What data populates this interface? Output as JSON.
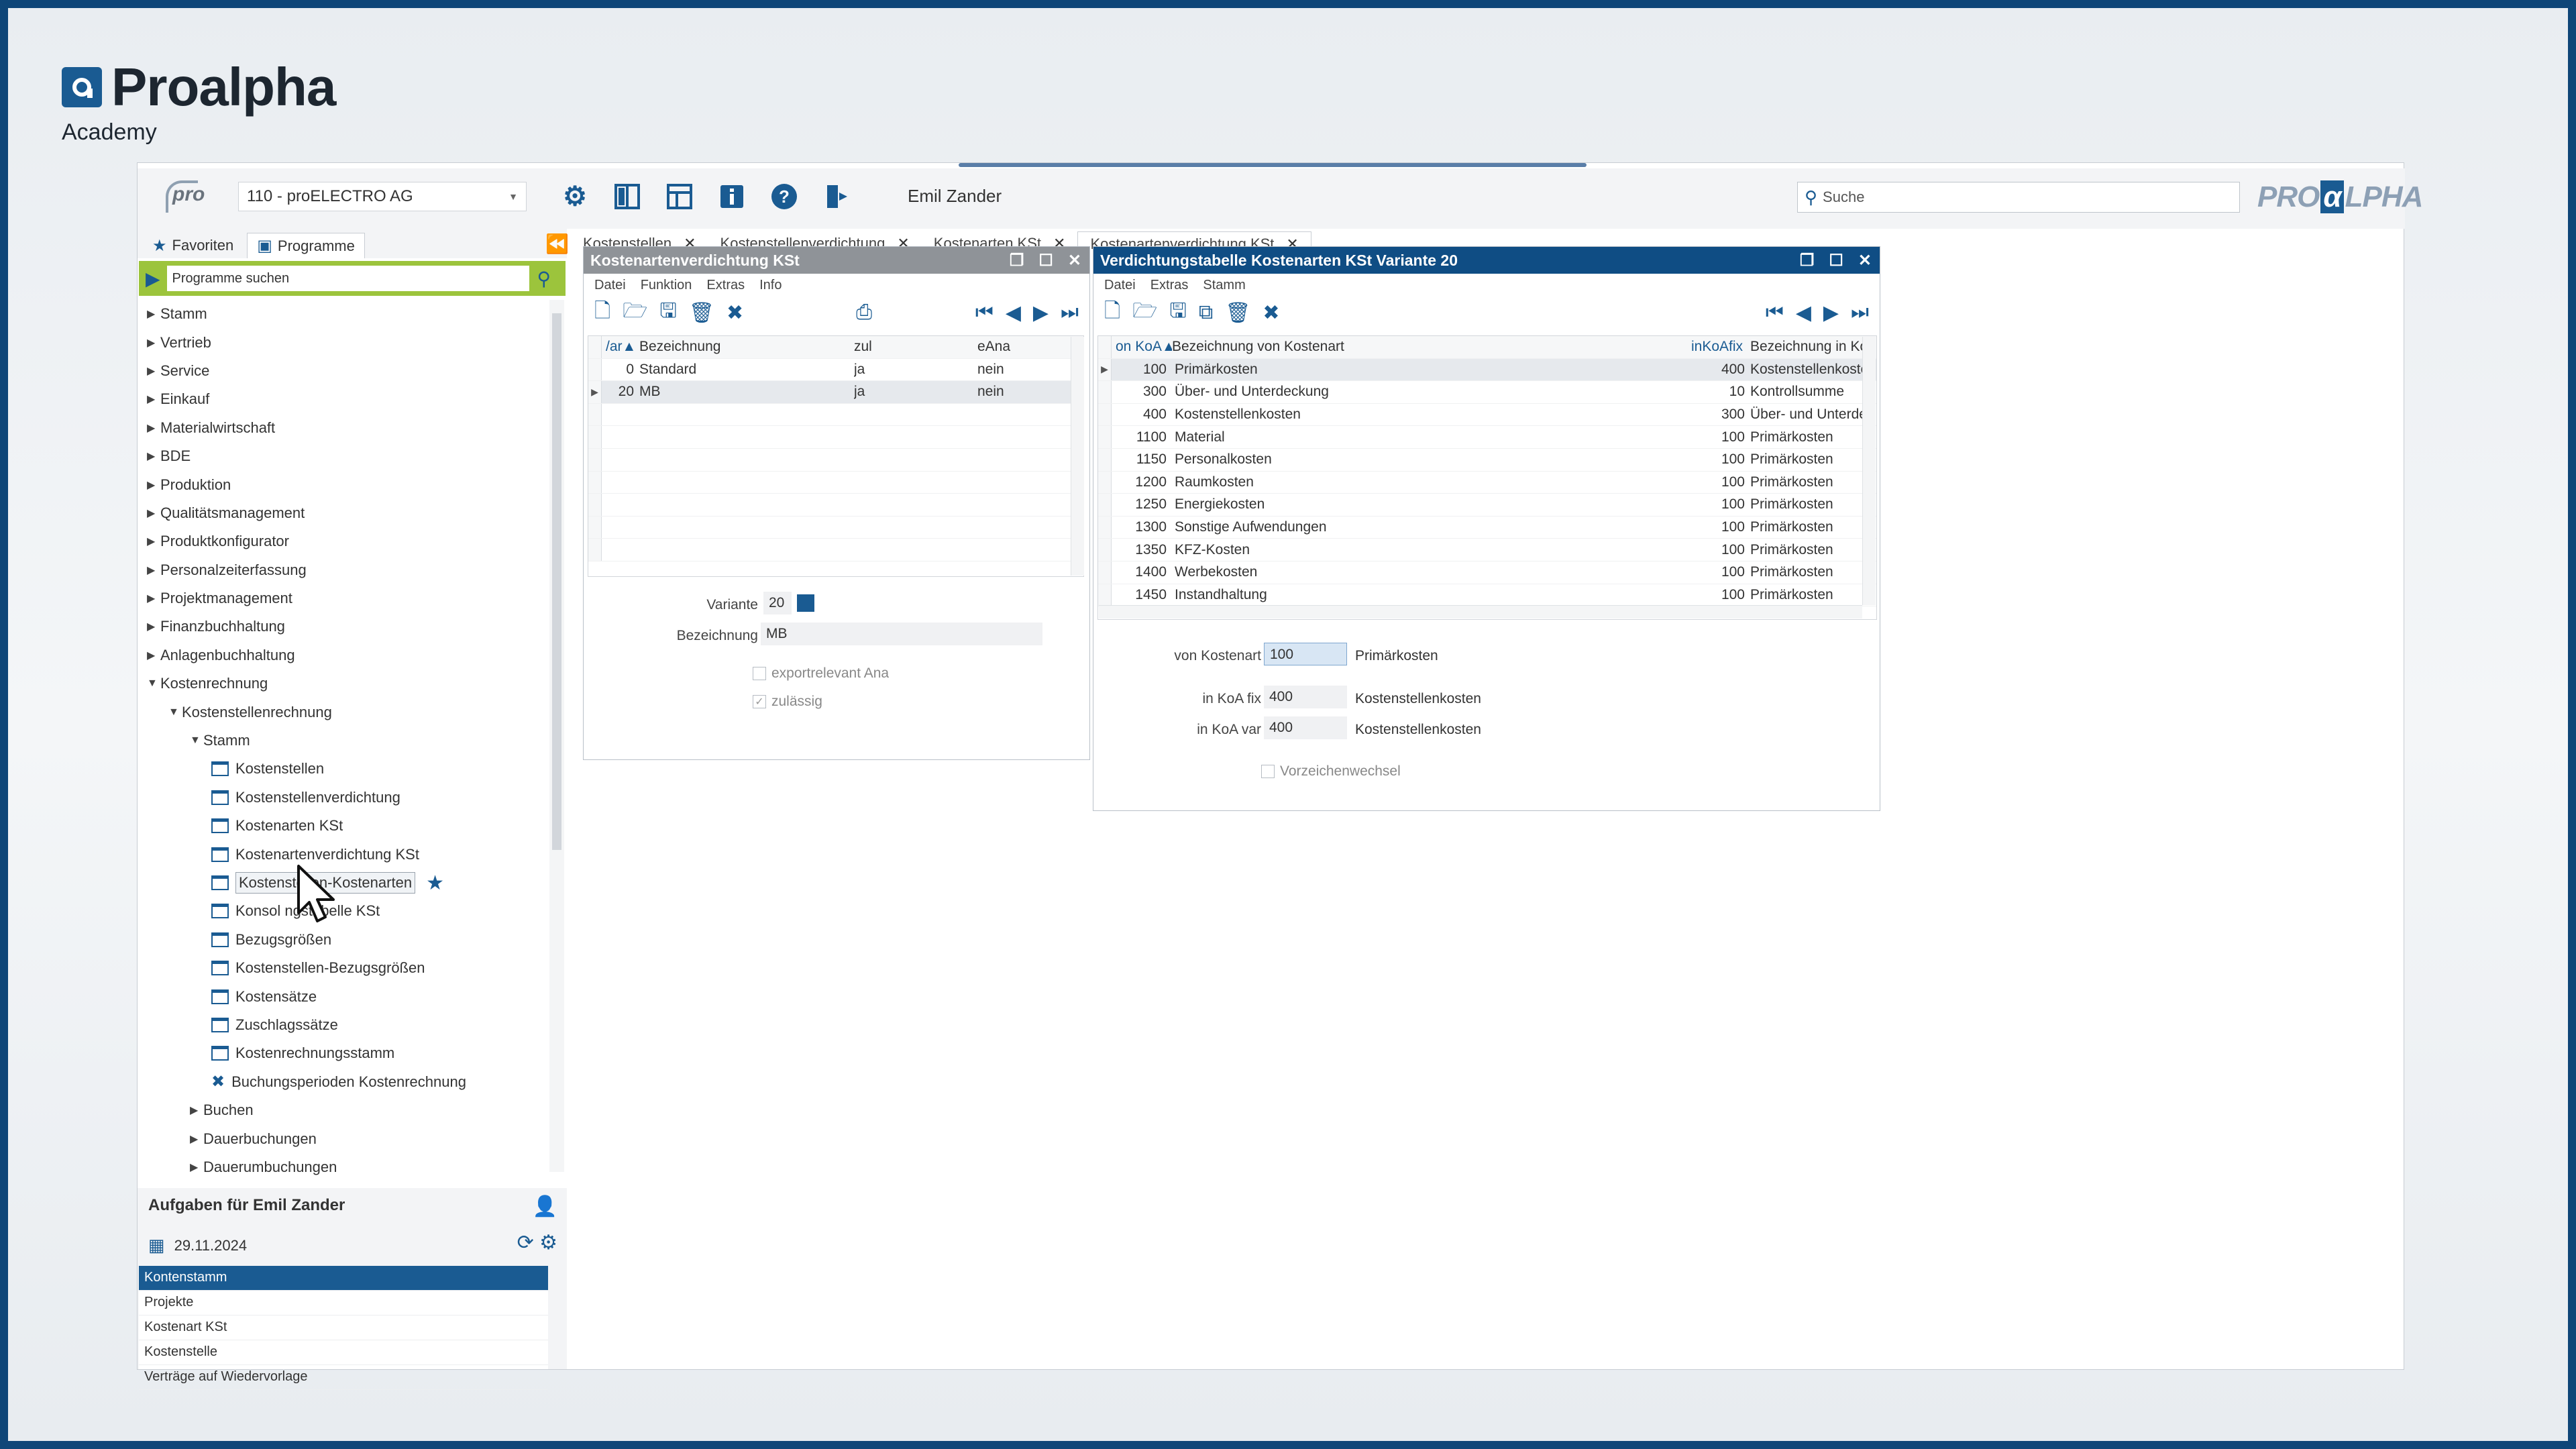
{
  "brand": {
    "name": "Proalpha",
    "subtitle": "Academy"
  },
  "topbar": {
    "pro_logo": "pro",
    "company": "110 - proELECTRO AG",
    "user": "Emil Zander",
    "search_placeholder": "Suche",
    "logo_left": "PRO",
    "logo_alpha": "α",
    "logo_right": "LPHA",
    "icons": [
      "gear-icon",
      "layout-columns-icon",
      "layout-split-icon",
      "info-icon",
      "help-icon",
      "exit-icon"
    ]
  },
  "sidebar": {
    "tabs": [
      {
        "label": "Favoriten",
        "icon": "star-icon"
      },
      {
        "label": "Programme",
        "icon": "programs-icon"
      }
    ],
    "search_placeholder": "Programme suchen",
    "tree": [
      {
        "label": "Stamm",
        "level": 0,
        "type": "folder",
        "open": false
      },
      {
        "label": "Vertrieb",
        "level": 0,
        "type": "folder",
        "open": false
      },
      {
        "label": "Service",
        "level": 0,
        "type": "folder",
        "open": false
      },
      {
        "label": "Einkauf",
        "level": 0,
        "type": "folder",
        "open": false
      },
      {
        "label": "Materialwirtschaft",
        "level": 0,
        "type": "folder",
        "open": false
      },
      {
        "label": "BDE",
        "level": 0,
        "type": "folder",
        "open": false
      },
      {
        "label": "Produktion",
        "level": 0,
        "type": "folder",
        "open": false
      },
      {
        "label": "Qualitätsmanagement",
        "level": 0,
        "type": "folder",
        "open": false
      },
      {
        "label": "Produktkonfigurator",
        "level": 0,
        "type": "folder",
        "open": false
      },
      {
        "label": "Personalzeiterfassung",
        "level": 0,
        "type": "folder",
        "open": false
      },
      {
        "label": "Projektmanagement",
        "level": 0,
        "type": "folder",
        "open": false
      },
      {
        "label": "Finanzbuchhaltung",
        "level": 0,
        "type": "folder",
        "open": false
      },
      {
        "label": "Anlagenbuchhaltung",
        "level": 0,
        "type": "folder",
        "open": false
      },
      {
        "label": "Kostenrechnung",
        "level": 0,
        "type": "folder",
        "open": true
      },
      {
        "label": "Kostenstellenrechnung",
        "level": 1,
        "type": "folder",
        "open": true
      },
      {
        "label": "Stamm",
        "level": 2,
        "type": "folder",
        "open": true
      },
      {
        "label": "Kostenstellen",
        "level": 3,
        "type": "doc"
      },
      {
        "label": "Kostenstellenverdichtung",
        "level": 3,
        "type": "doc"
      },
      {
        "label": "Kostenarten KSt",
        "level": 3,
        "type": "doc"
      },
      {
        "label": "Kostenartenverdichtung KSt",
        "level": 3,
        "type": "doc"
      },
      {
        "label": "Kostenstellen-Kostenarten",
        "level": 3,
        "type": "doc",
        "highlight": true,
        "star": true
      },
      {
        "label": "Konsol      ngstabelle KSt",
        "level": 3,
        "type": "doc"
      },
      {
        "label": "Bezugsgrößen",
        "level": 3,
        "type": "doc"
      },
      {
        "label": "Kostenstellen-Bezugsgrößen",
        "level": 3,
        "type": "doc"
      },
      {
        "label": "Kostensätze",
        "level": 3,
        "type": "doc"
      },
      {
        "label": "Zuschlagssätze",
        "level": 3,
        "type": "doc"
      },
      {
        "label": "Kostenrechnungsstamm",
        "level": 3,
        "type": "doc"
      },
      {
        "label": "Buchungsperioden Kostenrechnung",
        "level": 3,
        "type": "tool"
      },
      {
        "label": "Buchen",
        "level": 2,
        "type": "folder",
        "open": false
      },
      {
        "label": "Dauerbuchungen",
        "level": 2,
        "type": "folder",
        "open": false
      },
      {
        "label": "Dauerumbuchungen",
        "level": 2,
        "type": "folder",
        "open": false
      }
    ],
    "tasks": {
      "title": "Aufgaben für Emil Zander",
      "date": "29.11.2024",
      "items": [
        "Kontenstamm",
        "Projekte",
        "Kostenart KSt",
        "Kostenstelle",
        "Verträge auf Wiedervorlage"
      ]
    }
  },
  "tabs": [
    {
      "label": "Kostenstellen",
      "active": false
    },
    {
      "label": "Kostenstellenverdichtung",
      "active": false
    },
    {
      "label": "Kostenarten KSt",
      "active": false
    },
    {
      "label": "Kostenartenverdichtung KSt",
      "active": true
    }
  ],
  "win1": {
    "title": "Kostenartenverdichtung KSt",
    "menu": [
      "Datei",
      "Funktion",
      "Extras",
      "Info"
    ],
    "columns": [
      "/ar▲",
      "Bezeichnung",
      "zul",
      "eAna"
    ],
    "rows": [
      {
        "num": "0",
        "name": "Standard",
        "zul": "ja",
        "eana": "nein"
      },
      {
        "num": "20",
        "name": "MB",
        "zul": "ja",
        "eana": "nein"
      }
    ],
    "form": {
      "variante_label": "Variante",
      "variante_value": "20",
      "bez_label": "Bezeichnung",
      "bez_value": "MB",
      "chk1": "exportrelevant Ana",
      "chk2": "zulässig"
    }
  },
  "win2": {
    "title": "Verdichtungstabelle Kostenarten KSt Variante 20",
    "menu": [
      "Datei",
      "Extras",
      "Stamm"
    ],
    "columns": [
      "on KoA▲",
      "Bezeichnung von Kostenart",
      "inKoAfix",
      "Bezeichnung in Ko"
    ],
    "rows": [
      {
        "von": "100",
        "bez": "Primärkosten",
        "in": "400",
        "inbez": "Kostenstellenkoste"
      },
      {
        "von": "300",
        "bez": "Über- und Unterdeckung",
        "in": "10",
        "inbez": "Kontrollsumme"
      },
      {
        "von": "400",
        "bez": "Kostenstellenkosten",
        "in": "300",
        "inbez": "Über- und Unterde"
      },
      {
        "von": "1100",
        "bez": "Material",
        "in": "100",
        "inbez": "Primärkosten"
      },
      {
        "von": "1150",
        "bez": "Personalkosten",
        "in": "100",
        "inbez": "Primärkosten"
      },
      {
        "von": "1200",
        "bez": "Raumkosten",
        "in": "100",
        "inbez": "Primärkosten"
      },
      {
        "von": "1250",
        "bez": "Energiekosten",
        "in": "100",
        "inbez": "Primärkosten"
      },
      {
        "von": "1300",
        "bez": "Sonstige Aufwendungen",
        "in": "100",
        "inbez": "Primärkosten"
      },
      {
        "von": "1350",
        "bez": "KFZ-Kosten",
        "in": "100",
        "inbez": "Primärkosten"
      },
      {
        "von": "1400",
        "bez": "Werbekosten",
        "in": "100",
        "inbez": "Primärkosten"
      },
      {
        "von": "1450",
        "bez": "Instandhaltung",
        "in": "100",
        "inbez": "Primärkosten"
      }
    ],
    "form": {
      "von_label": "von Kostenart",
      "von_value": "100",
      "von_text": "Primärkosten",
      "fix_label": "in KoA fix",
      "fix_value": "400",
      "fix_text": "Kostenstellenkosten",
      "var_label": "in KoA var",
      "var_value": "400",
      "var_text": "Kostenstellenkosten",
      "chk": "Vorzeichenwechsel"
    }
  },
  "colors": {
    "accent": "#1a5b92",
    "green": "#9cc43c",
    "win1_title": "#8f9398",
    "win2_title": "#0f4d84"
  }
}
